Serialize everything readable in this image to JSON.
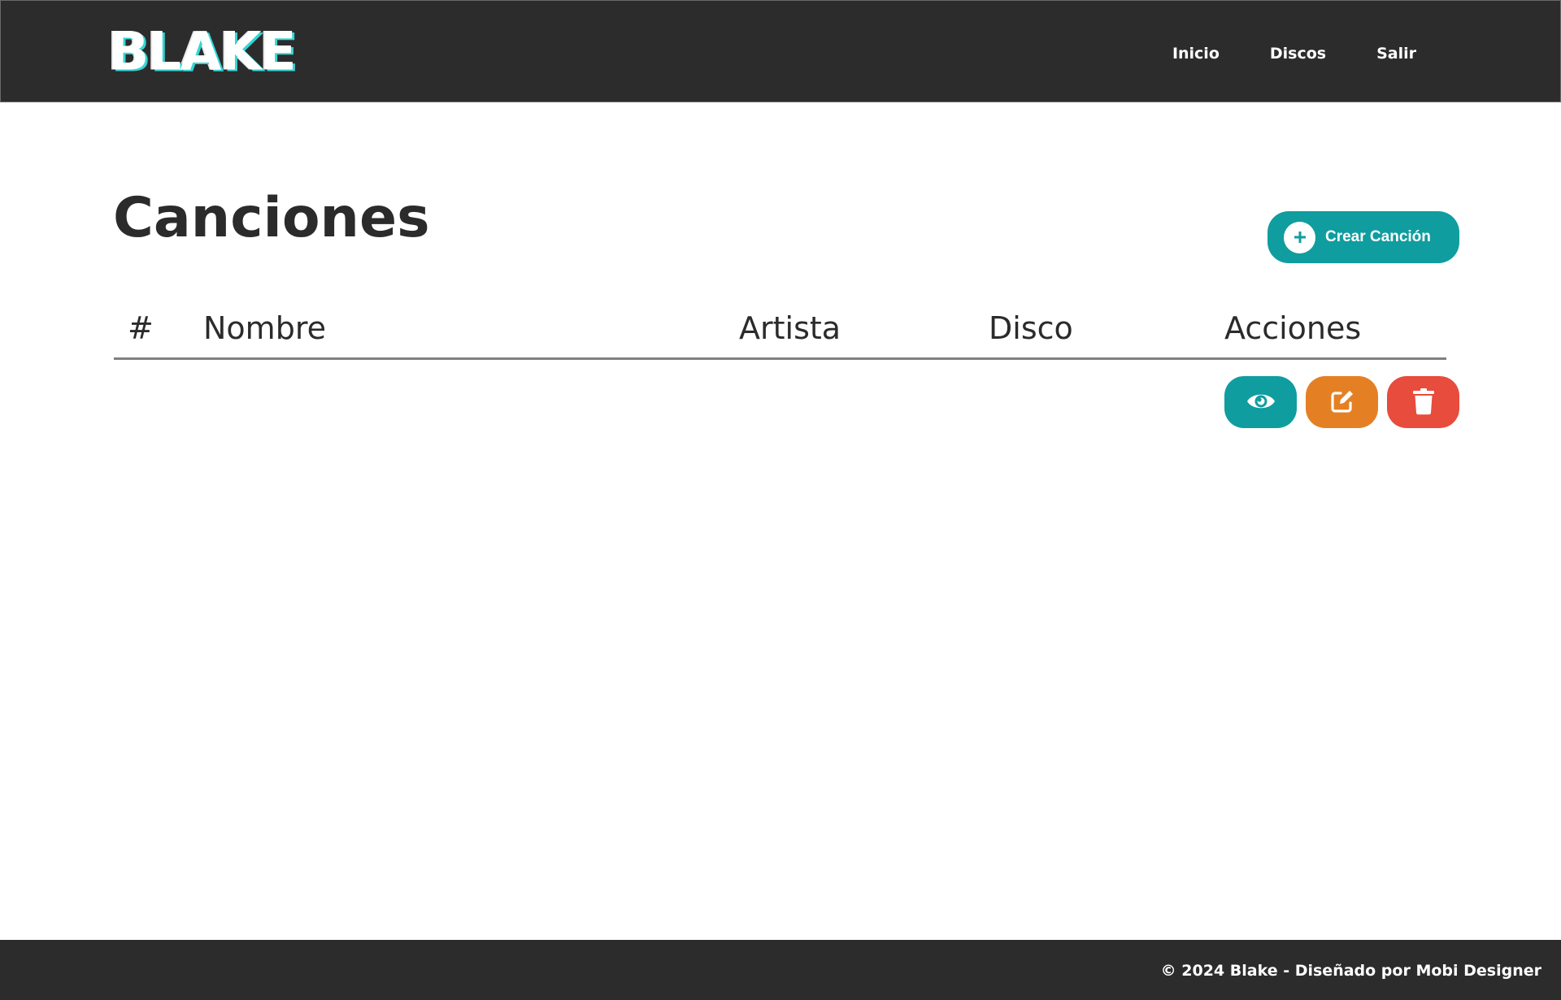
{
  "brand": {
    "logo_text": "BLAKE",
    "accent_color": "#35d6d6"
  },
  "nav": {
    "items": [
      {
        "label": "Inicio"
      },
      {
        "label": "Discos"
      },
      {
        "label": "Salir"
      }
    ]
  },
  "main": {
    "title": "Canciones",
    "create_button": {
      "label": "Crear Canción",
      "icon": "plus-circle-icon",
      "color": "#109d9f"
    },
    "table": {
      "columns": [
        "#",
        "Nombre",
        "Artista",
        "Disco",
        "Acciones"
      ],
      "rows": [
        {
          "number": "",
          "name": "",
          "artist": "",
          "disc": "",
          "actions": [
            {
              "name": "view",
              "icon": "eye-icon",
              "color": "#109d9f"
            },
            {
              "name": "edit",
              "icon": "edit-icon",
              "color": "#e48023"
            },
            {
              "name": "delete",
              "icon": "trash-icon",
              "color": "#e74c3c"
            }
          ]
        }
      ]
    }
  },
  "footer": {
    "text": "© 2024 Blake - Diseñado por Mobi Designer"
  }
}
